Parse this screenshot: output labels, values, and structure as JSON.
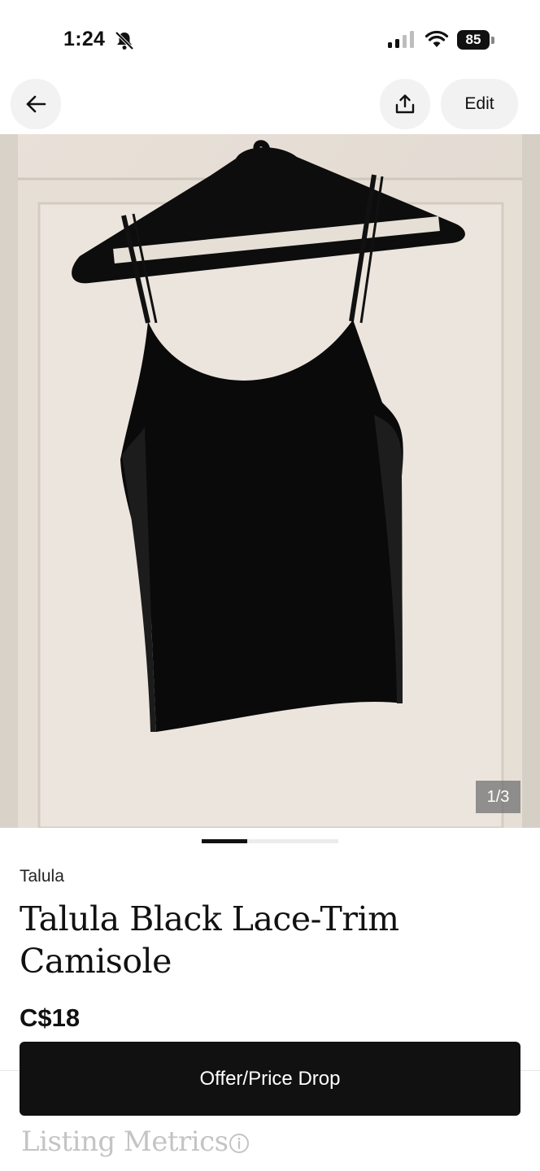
{
  "status_bar": {
    "time": "1:24",
    "battery": "85",
    "icons": [
      "bell-slash-icon",
      "cellular-signal-icon",
      "wifi-icon",
      "battery-icon"
    ]
  },
  "nav": {
    "back_icon": "arrow-left-icon",
    "share_icon": "share-upload-icon",
    "edit_label": "Edit"
  },
  "gallery": {
    "counter": "1/3",
    "current": 1,
    "total": 3
  },
  "listing": {
    "brand": "Talula",
    "title": "Talula Black Lace-Trim Camisole",
    "price": "C$18"
  },
  "actions": {
    "offer_label": "Offer/Price Drop"
  },
  "metrics": {
    "heading": "Listing Metrics",
    "info_icon": "info-circle-icon"
  },
  "colors": {
    "cta_background": "#111111",
    "metrics_heading": "#c4c4c4"
  }
}
